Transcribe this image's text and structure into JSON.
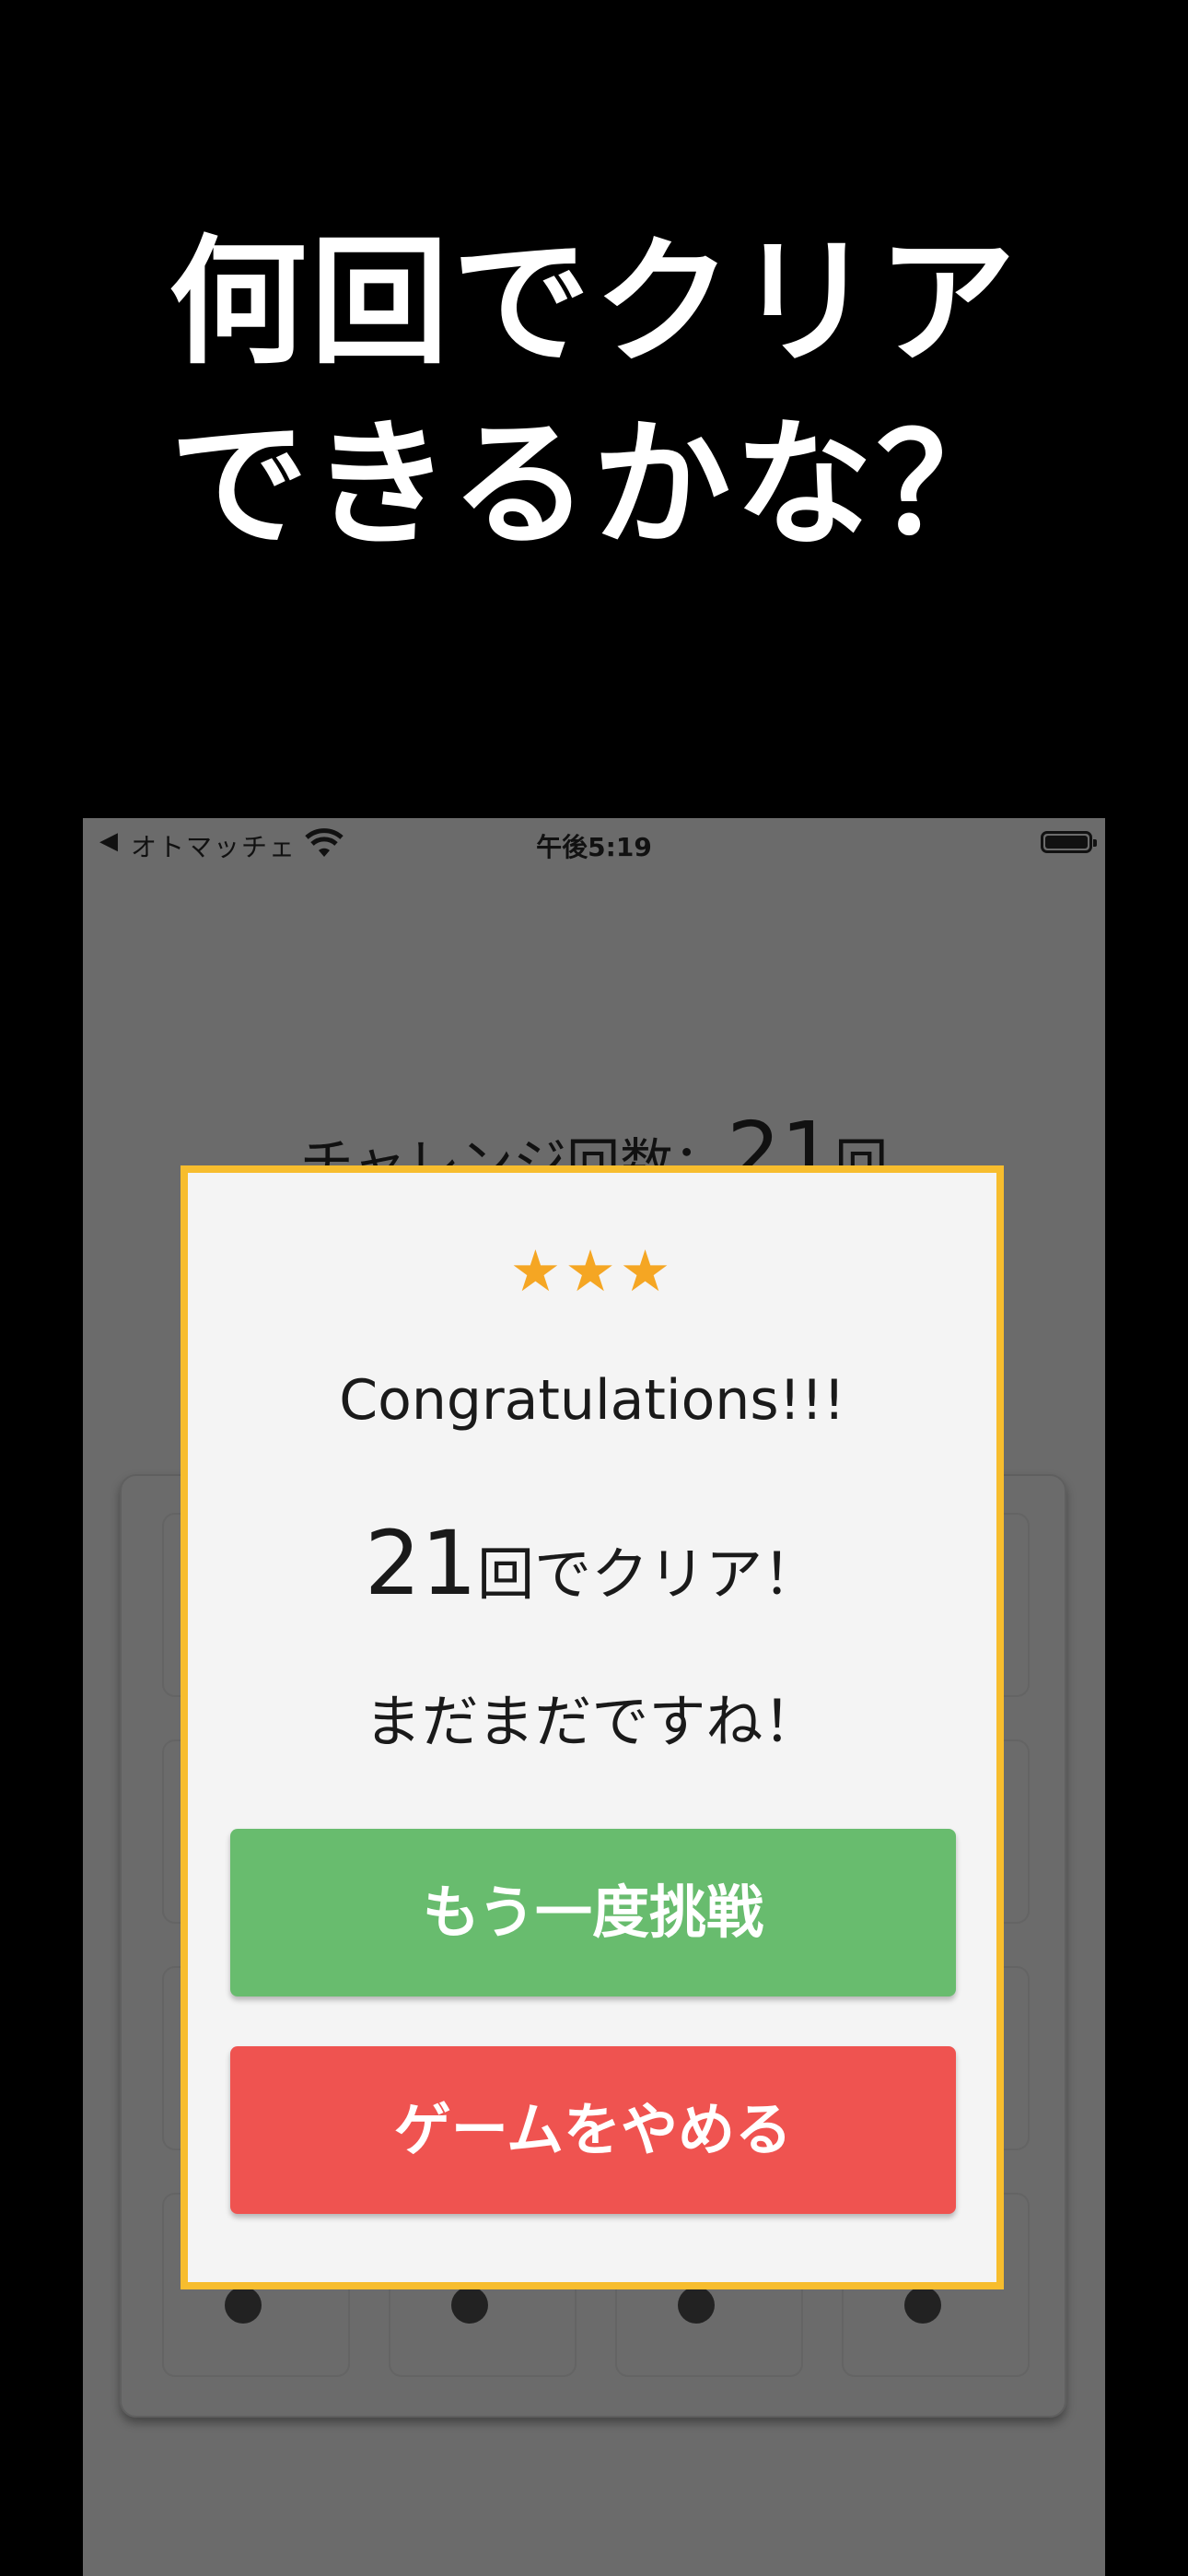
{
  "promo": {
    "line1": "何回でクリア",
    "line2": "できるかな？"
  },
  "status_bar": {
    "back_arrow": "◀",
    "carrier": "オトマッチェ",
    "time": "午後5:19"
  },
  "game": {
    "challenge_label": "チャレンジ回数：",
    "challenge_count": "21",
    "challenge_unit": "回"
  },
  "modal": {
    "stars": "★★★",
    "title": "Congratulations!!!",
    "result_count": "21",
    "result_text": "回でクリア！",
    "comment": "まだまだですね！",
    "retry_label": "もう一度挑戦",
    "quit_label": "ゲームをやめる"
  },
  "colors": {
    "modal_border": "#f7bd2e",
    "star": "#f5a623",
    "retry_button": "#68bc6e",
    "quit_button": "#ef5350",
    "overlay": "#6b6b6b"
  }
}
